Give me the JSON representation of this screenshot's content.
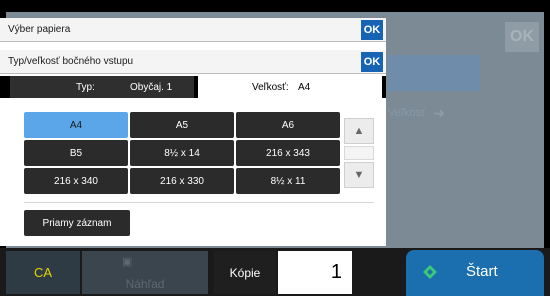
{
  "dialog": {
    "title": "Výber papiera",
    "ok_label": "OK",
    "subtitle": "Typ/veľkosť bočného vstupu",
    "ok2_label": "OK",
    "tabs": [
      {
        "label": "Typ:",
        "value": "Obyčaj. 1",
        "active": false
      },
      {
        "label": "Veľkosť:",
        "value": "A4",
        "active": true
      }
    ],
    "sizes": [
      {
        "label": "A4",
        "selected": true
      },
      {
        "label": "A5",
        "selected": false
      },
      {
        "label": "A6",
        "selected": false
      },
      {
        "label": "B5",
        "selected": false
      },
      {
        "label": "8½ x 14",
        "selected": false
      },
      {
        "label": "216 x 343",
        "selected": false
      },
      {
        "label": "216 x 340",
        "selected": false
      },
      {
        "label": "216 x 330",
        "selected": false
      },
      {
        "label": "8½ x 11",
        "selected": false
      }
    ],
    "scroll_up_icon": "double-chevron-up-icon",
    "scroll_down_icon": "double-chevron-down-icon",
    "direct_entry_label": "Priamy záznam"
  },
  "background": {
    "ok_label": "OK",
    "size_label": "Veľkosť"
  },
  "bottom_bar": {
    "ca_label": "CA",
    "preview_label": "Náhľad",
    "copies_label": "Kópie",
    "copies_value": "1",
    "start_label": "Štart"
  },
  "colors": {
    "accent_blue": "#1864b4",
    "selected_size": "#5aa6e8",
    "start_button": "#1c6fae",
    "ca_text": "#e8d400"
  }
}
